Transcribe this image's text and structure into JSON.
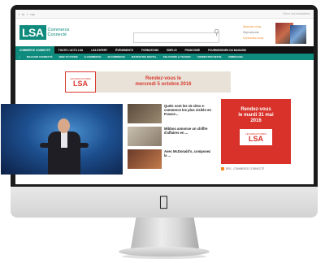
{
  "colors": {
    "brand": "#0f8b7d",
    "accent": "#d8322a",
    "nav_dark": "#111111"
  },
  "topbar": {
    "social": [
      "f",
      "in",
      "t",
      "rss"
    ],
    "right_text": "Gérer vos newsletters"
  },
  "logo": {
    "mark": "LSA",
    "subtitle": "Commerce Connecté"
  },
  "search": {
    "placeholder": ""
  },
  "subscribe": {
    "line1": "Abonnez-vous",
    "line2": "Déjà abonné",
    "line3": "Connectez-vous"
  },
  "nav_primary": [
    "COMMERCE CONNECTÉ",
    "TOUTE L'ACTU LSA",
    "LSA EXPERT",
    "ÉVÉNEMENTS",
    "FORMATIONS",
    "EMPLOI",
    "FRANCHISE",
    "FOURNISSEURS DU MAGASIN"
  ],
  "nav_secondary": [
    "MAGASIN CONNECTÉ",
    "WEB TO STORE",
    "E-COMMERCE",
    "M-COMMERCE",
    "MARKETING DIGITAL",
    "SOLUTIONS & TECHNO",
    "CONNECTED RETAIL",
    "OMNICANAL"
  ],
  "banner": {
    "tagline": "LES RENCONTRES",
    "logo": "LSA",
    "text_line1": "Rendez-vous le",
    "text_line2": "mercredi 5 octobre 2016"
  },
  "articles": [
    {
      "title": "Quels sont les 15 sites e-commerce les plus visités en France..."
    },
    {
      "title": "Mibboo annonce un chiffre d'affaires en ..."
    },
    {
      "title": "Avec McDonald's, composez la ..."
    }
  ],
  "side_ad": {
    "line1": "Rendez-vous",
    "line2": "le mardi 31 mai",
    "line3": "2016",
    "tagline": "LES RENCONTRES",
    "logo": "LSA"
  },
  "rss": {
    "label": "RSS - COMMERCE CONNECTÉ"
  },
  "device": {
    "brand_icon": "apple-logo-icon"
  }
}
